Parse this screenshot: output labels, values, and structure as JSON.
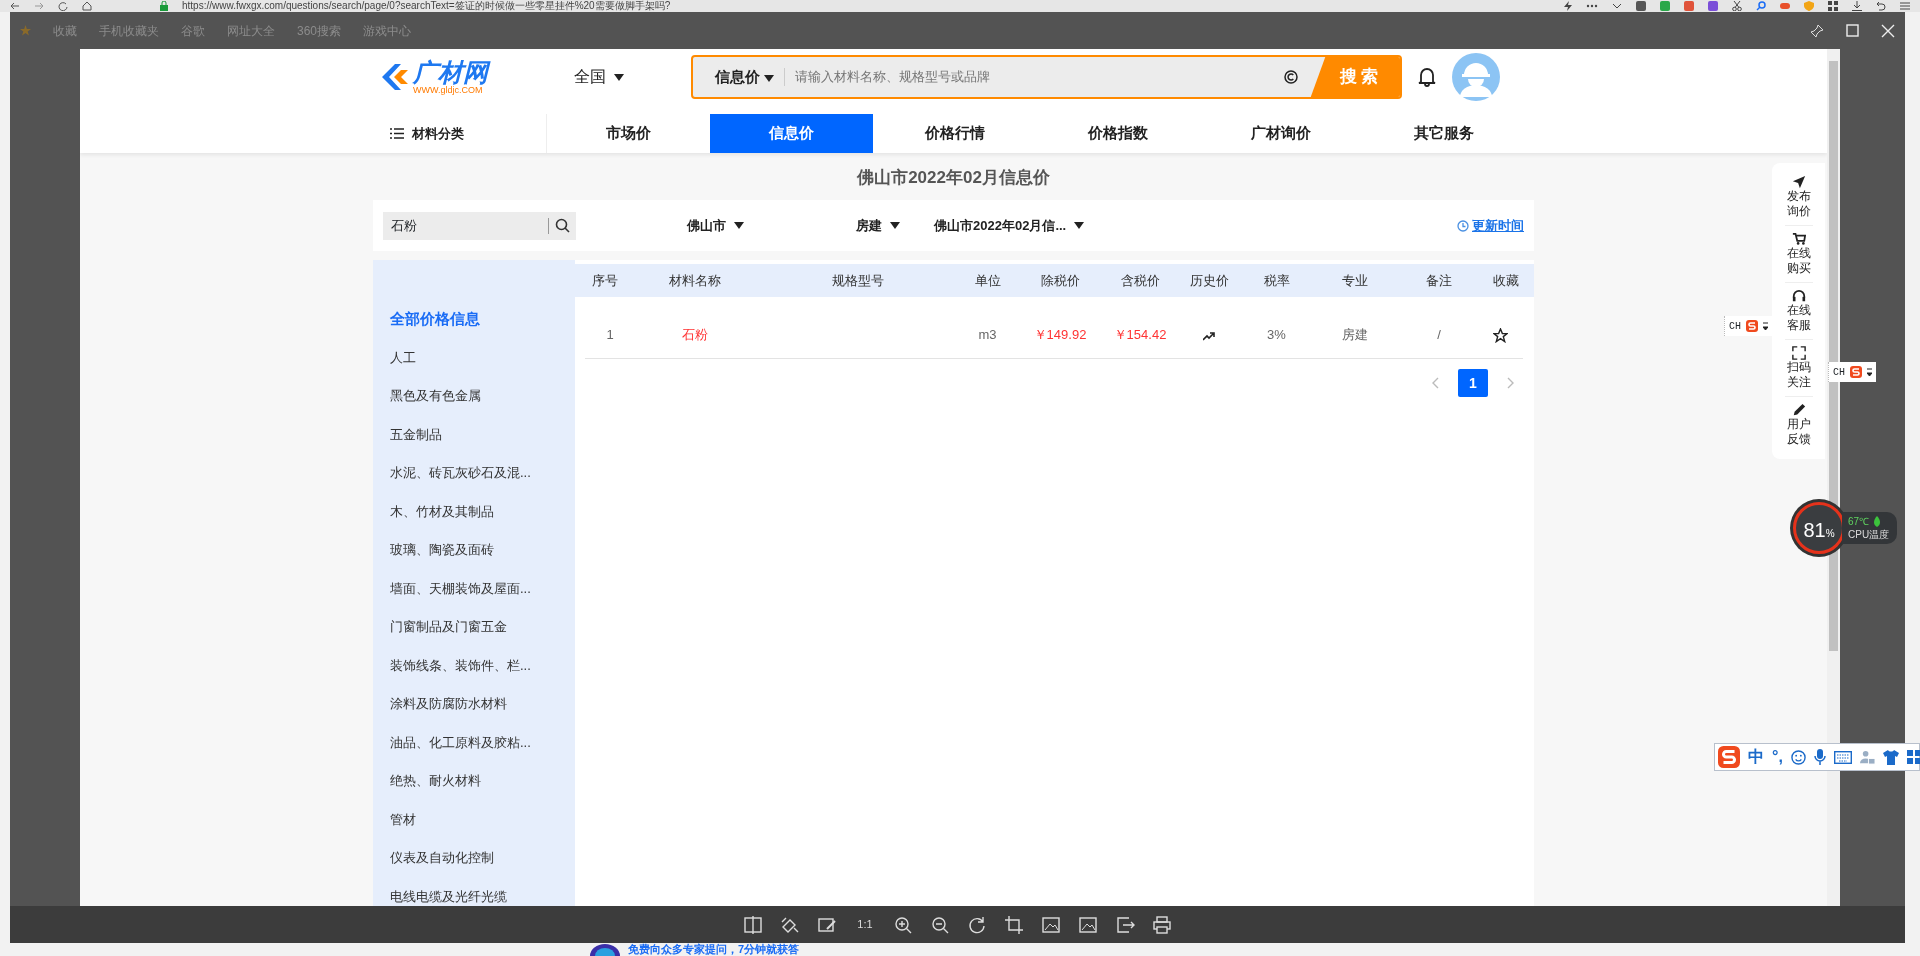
{
  "browser": {
    "address": "https://www.fwxgx.com/questions/search/page/0?searchText=签证的时候做一些零星挂件%20需要做脚手架吗?",
    "bookmarks": [
      "收藏",
      "手机收藏夹",
      "谷歌",
      "网址大全",
      "360搜索",
      "游戏中心"
    ]
  },
  "site": {
    "logo": {
      "name": "广材网",
      "domain": "WWW.gldjc.COM"
    },
    "region": "全国",
    "search": {
      "scope": "信息价",
      "placeholder": "请输入材料名称、规格型号或品牌",
      "button": "搜 索"
    },
    "nav": [
      {
        "label": "材料分类",
        "kind": "menu",
        "selected": false
      },
      {
        "label": "市场价",
        "kind": "tab",
        "selected": false
      },
      {
        "label": "信息价",
        "kind": "tab",
        "selected": true
      },
      {
        "label": "价格行情",
        "kind": "tab",
        "selected": false
      },
      {
        "label": "价格指数",
        "kind": "tab",
        "selected": false
      },
      {
        "label": "广材询价",
        "kind": "tab",
        "selected": false
      },
      {
        "label": "其它服务",
        "kind": "tab",
        "selected": false
      }
    ]
  },
  "page": {
    "title": "佛山市2022年02月信息价",
    "filters": {
      "keyword": "石粉",
      "city": "佛山市",
      "category": "房建",
      "period": "佛山市2022年02月信...",
      "update_link": "更新时间"
    },
    "sidebar": [
      {
        "label": "全部价格信息",
        "selected": true
      },
      {
        "label": "人工",
        "selected": false
      },
      {
        "label": "黑色及有色金属",
        "selected": false
      },
      {
        "label": "五金制品",
        "selected": false
      },
      {
        "label": "水泥、砖瓦灰砂石及混...",
        "selected": false
      },
      {
        "label": "木、竹材及其制品",
        "selected": false
      },
      {
        "label": "玻璃、陶瓷及面砖",
        "selected": false
      },
      {
        "label": "墙面、天棚装饰及屋面...",
        "selected": false
      },
      {
        "label": "门窗制品及门窗五金",
        "selected": false
      },
      {
        "label": "装饰线条、装饰件、栏...",
        "selected": false
      },
      {
        "label": "涂料及防腐防水材料",
        "selected": false
      },
      {
        "label": "油品、化工原料及胶粘...",
        "selected": false
      },
      {
        "label": "绝热、耐火材料",
        "selected": false
      },
      {
        "label": "管材",
        "selected": false
      },
      {
        "label": "仪表及自动化控制",
        "selected": false
      },
      {
        "label": "电线电缆及光纤光缆",
        "selected": false
      }
    ],
    "table": {
      "columns": [
        "序号",
        "材料名称",
        "规格型号",
        "单位",
        "除税价",
        "含税价",
        "历史价",
        "税率",
        "专业",
        "备注",
        "收藏"
      ],
      "rows": [
        {
          "index": "1",
          "name": "石粉",
          "unit": "m3",
          "price_ex_tax": "￥149.92",
          "price_inc_tax": "￥154.42",
          "tax_rate": "3%",
          "specialty": "房建",
          "note": "/",
          "favorited": false
        }
      ]
    },
    "pagination": {
      "pages": [
        {
          "label": "1",
          "selected": true
        }
      ]
    }
  },
  "float_panel": [
    {
      "kind": "send",
      "label": "发布询价"
    },
    {
      "kind": "cart",
      "label": "在线购买"
    },
    {
      "kind": "headset",
      "label": "在线客服"
    },
    {
      "kind": "qr",
      "label": "扫码关注"
    },
    {
      "kind": "pen",
      "label": "用户反馈"
    }
  ],
  "ime_popups": [
    {
      "text": "CH"
    },
    {
      "text": "CH"
    }
  ],
  "cpu_widget": {
    "load": "81",
    "unit": "%",
    "temperature": "67℃",
    "label": "CPU温度"
  },
  "ime_toolbar": {
    "mode": "中",
    "punctuation": "°,"
  },
  "viewer_toolbar": [
    {
      "kind": "compare"
    },
    {
      "kind": "erase"
    },
    {
      "kind": "edit"
    },
    {
      "kind": "actual",
      "label": "1:1"
    },
    {
      "kind": "zoom_in"
    },
    {
      "kind": "zoom_out"
    },
    {
      "kind": "rotate"
    },
    {
      "kind": "crop"
    },
    {
      "kind": "image"
    },
    {
      "kind": "image"
    },
    {
      "kind": "export"
    },
    {
      "kind": "print"
    }
  ],
  "footer_text": "免费向众多专家提问，7分钟就获答"
}
